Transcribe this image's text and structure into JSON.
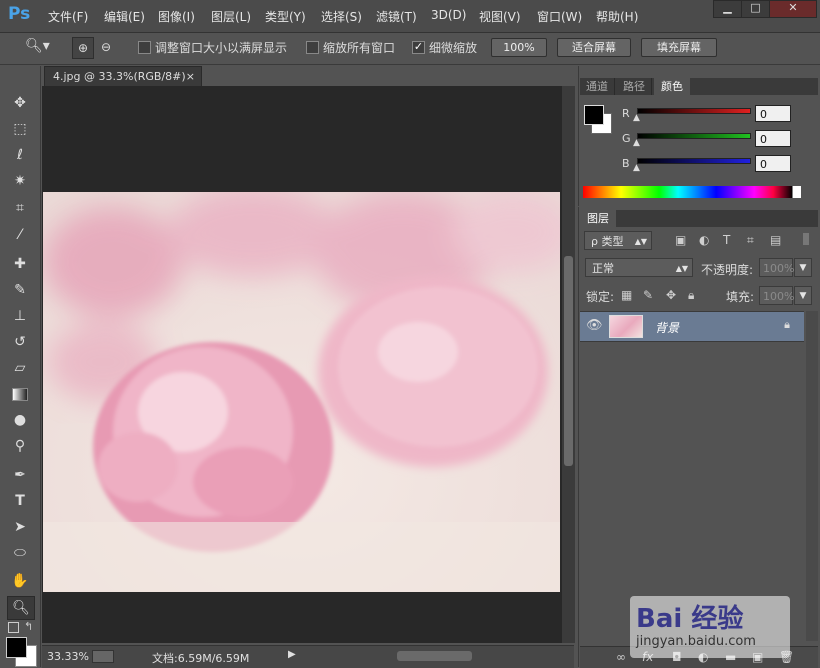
{
  "app": {
    "logo": "Ps"
  },
  "menu": [
    {
      "label": "文件(F)"
    },
    {
      "label": "编辑(E)"
    },
    {
      "label": "图像(I)"
    },
    {
      "label": "图层(L)"
    },
    {
      "label": "类型(Y)"
    },
    {
      "label": "选择(S)"
    },
    {
      "label": "滤镜(T)"
    },
    {
      "label": "3D(D)"
    },
    {
      "label": "视图(V)"
    },
    {
      "label": "窗口(W)"
    },
    {
      "label": "帮助(H)"
    }
  ],
  "window_controls": {
    "minimize": "▁",
    "maximize": "□",
    "close": "✕"
  },
  "options": {
    "resize_windows_label": "调整窗口大小以满屏显示",
    "resize_windows_checked": false,
    "zoom_all_label": "缩放所有窗口",
    "zoom_all_checked": false,
    "scrubby_zoom_label": "细微缩放",
    "scrubby_zoom_checked": true,
    "btn_100": "100%",
    "btn_fit": "适合屏幕",
    "btn_fill": "填充屏幕"
  },
  "document": {
    "tab_title": "4.jpg @ 33.3%(RGB/8#)",
    "close": "×",
    "zoom": "33.33%",
    "doc_info": "文档:6.59M/6.59M"
  },
  "color_panel": {
    "tabs": [
      "通道",
      "路径",
      "颜色"
    ],
    "active_tab": 2,
    "channels": [
      {
        "label": "R",
        "value": "0",
        "color": "#e02020"
      },
      {
        "label": "G",
        "value": "0",
        "color": "#20c020"
      },
      {
        "label": "B",
        "value": "0",
        "color": "#2020e0"
      }
    ],
    "foreground": "#000000",
    "background": "#ffffff"
  },
  "layers_panel": {
    "tab": "图层",
    "filter_label": "ρ 类型",
    "blend_mode": "正常",
    "opacity_label": "不透明度:",
    "opacity_value": "100%",
    "lock_label": "锁定:",
    "fill_label": "填充:",
    "fill_value": "100%",
    "layers": [
      {
        "name": "背景",
        "visible": true,
        "locked": true,
        "selected": true
      }
    ]
  },
  "watermark": {
    "brand": "Bai 经验",
    "url": "jingyan.baidu.com"
  }
}
